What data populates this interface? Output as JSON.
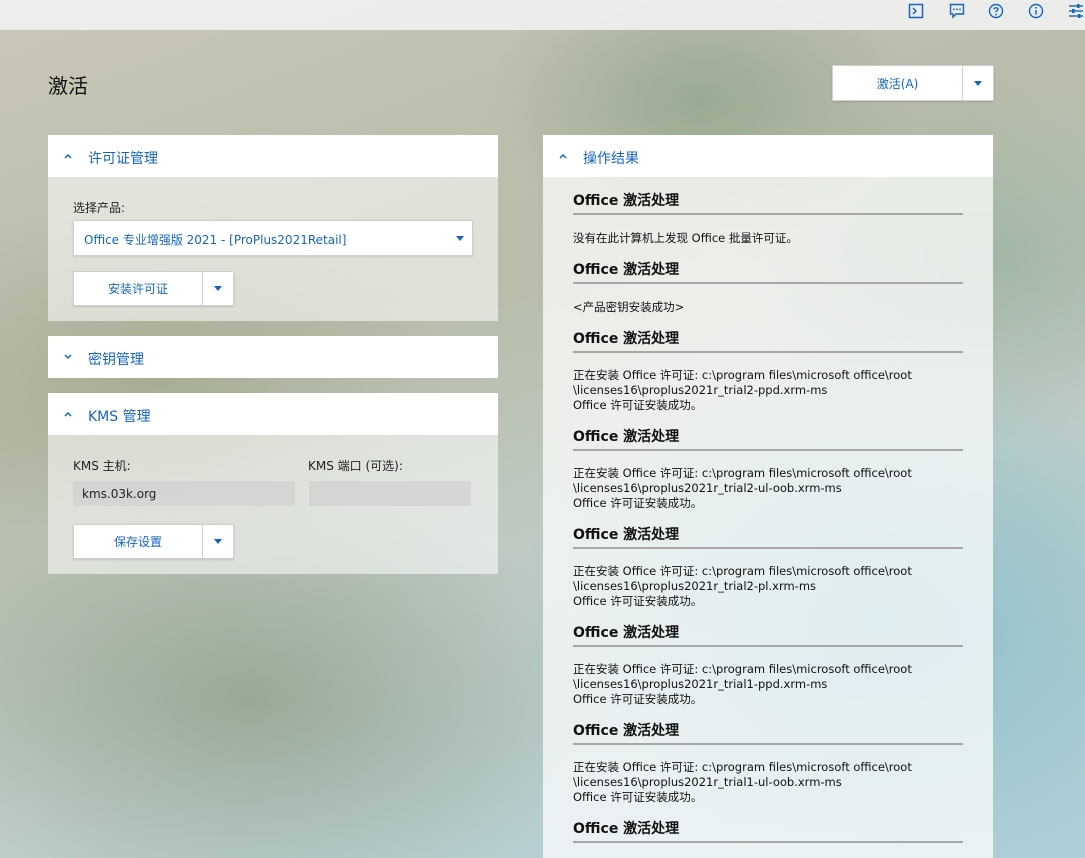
{
  "toolbar": {
    "icons": [
      "terminal-icon",
      "feedback-icon",
      "help-icon",
      "info-icon",
      "settings-icon"
    ]
  },
  "page": {
    "title": "激活",
    "activate_button": "激活(A)"
  },
  "license_panel": {
    "title": "许可证管理",
    "product_label": "选择产品:",
    "product_value": "Office 专业增强版 2021 - [ProPlus2021Retail]",
    "install_button": "安装许可证"
  },
  "key_panel": {
    "title": "密钥管理"
  },
  "kms_panel": {
    "title": "KMS 管理",
    "host_label": "KMS 主机:",
    "host_value": "kms.03k.org",
    "port_label": "KMS 端口 (可选):",
    "port_value": "",
    "save_button": "保存设置"
  },
  "results_panel": {
    "title": "操作结果",
    "entries": [
      {
        "title": "Office 激活处理",
        "message": "没有在此计算机上发现 Office 批量许可证。"
      },
      {
        "title": "Office 激活处理",
        "message": "<产品密钥安装成功>"
      },
      {
        "title": "Office 激活处理",
        "message": "正在安装 Office 许可证: c:\\program files\\microsoft office\\root\n\\licenses16\\proplus2021r_trial2-ppd.xrm-ms\nOffice 许可证安装成功。"
      },
      {
        "title": "Office 激活处理",
        "message": "正在安装 Office 许可证: c:\\program files\\microsoft office\\root\n\\licenses16\\proplus2021r_trial2-ul-oob.xrm-ms\nOffice 许可证安装成功。"
      },
      {
        "title": "Office 激活处理",
        "message": "正在安装 Office 许可证: c:\\program files\\microsoft office\\root\n\\licenses16\\proplus2021r_trial2-pl.xrm-ms\nOffice 许可证安装成功。"
      },
      {
        "title": "Office 激活处理",
        "message": "正在安装 Office 许可证: c:\\program files\\microsoft office\\root\n\\licenses16\\proplus2021r_trial1-ppd.xrm-ms\nOffice 许可证安装成功。"
      },
      {
        "title": "Office 激活处理",
        "message": "正在安装 Office 许可证: c:\\program files\\microsoft office\\root\n\\licenses16\\proplus2021r_trial1-ul-oob.xrm-ms\nOffice 许可证安装成功。"
      },
      {
        "title": "Office 激活处理",
        "message": ""
      }
    ]
  },
  "colors": {
    "accent": "#1565c0",
    "panel_header": "#ffffff",
    "divider": "#a8a8a8"
  }
}
